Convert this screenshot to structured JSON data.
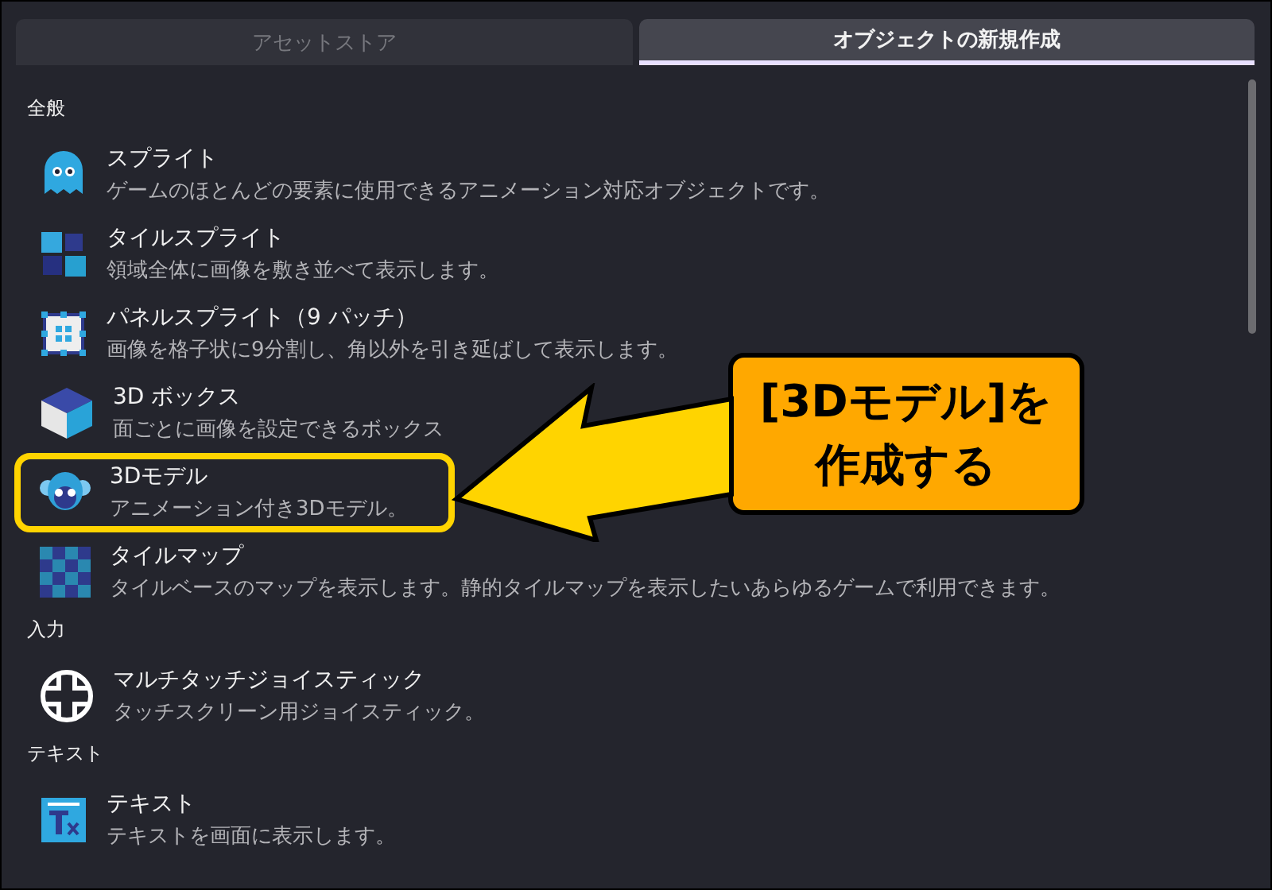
{
  "tabs": [
    {
      "label": "アセットストア",
      "selected": false
    },
    {
      "label": "オブジェクトの新規作成",
      "selected": true
    }
  ],
  "sections": [
    {
      "title": "全般",
      "items": [
        {
          "kind": "ghost",
          "title": "スプライト",
          "description": "ゲームのほとんどの要素に使用できるアニメーション対応オブジェクトです。",
          "highlighted": false
        },
        {
          "kind": "tiles",
          "title": "タイルスプライト",
          "description": "領域全体に画像を敷き並べて表示します。",
          "highlighted": false
        },
        {
          "kind": "panel",
          "title": "パネルスプライト（9 パッチ）",
          "description": "画像を格子状に9分割し、角以外を引き延ばして表示します。",
          "highlighted": false
        },
        {
          "kind": "cube",
          "title": "3D ボックス",
          "description": "面ごとに画像を設定できるボックス",
          "highlighted": false
        },
        {
          "kind": "monkey",
          "title": "3Dモデル",
          "description": "アニメーション付き3Dモデル。",
          "highlighted": true
        },
        {
          "kind": "checker",
          "title": "タイルマップ",
          "description": "タイルベースのマップを表示します。静的タイルマップを表示したいあらゆるゲームで利用できます。",
          "highlighted": false
        }
      ]
    },
    {
      "title": "入力",
      "items": [
        {
          "kind": "joystick",
          "title": "マルチタッチジョイスティック",
          "description": "タッチスクリーン用ジョイスティック。",
          "highlighted": false
        }
      ]
    },
    {
      "title": "テキスト",
      "items": [
        {
          "kind": "text",
          "title": "テキスト",
          "description": "テキストを画面に表示します。",
          "highlighted": false
        }
      ]
    }
  ],
  "callout": {
    "lines": [
      "[3Dモデル]を",
      "作成する"
    ]
  }
}
